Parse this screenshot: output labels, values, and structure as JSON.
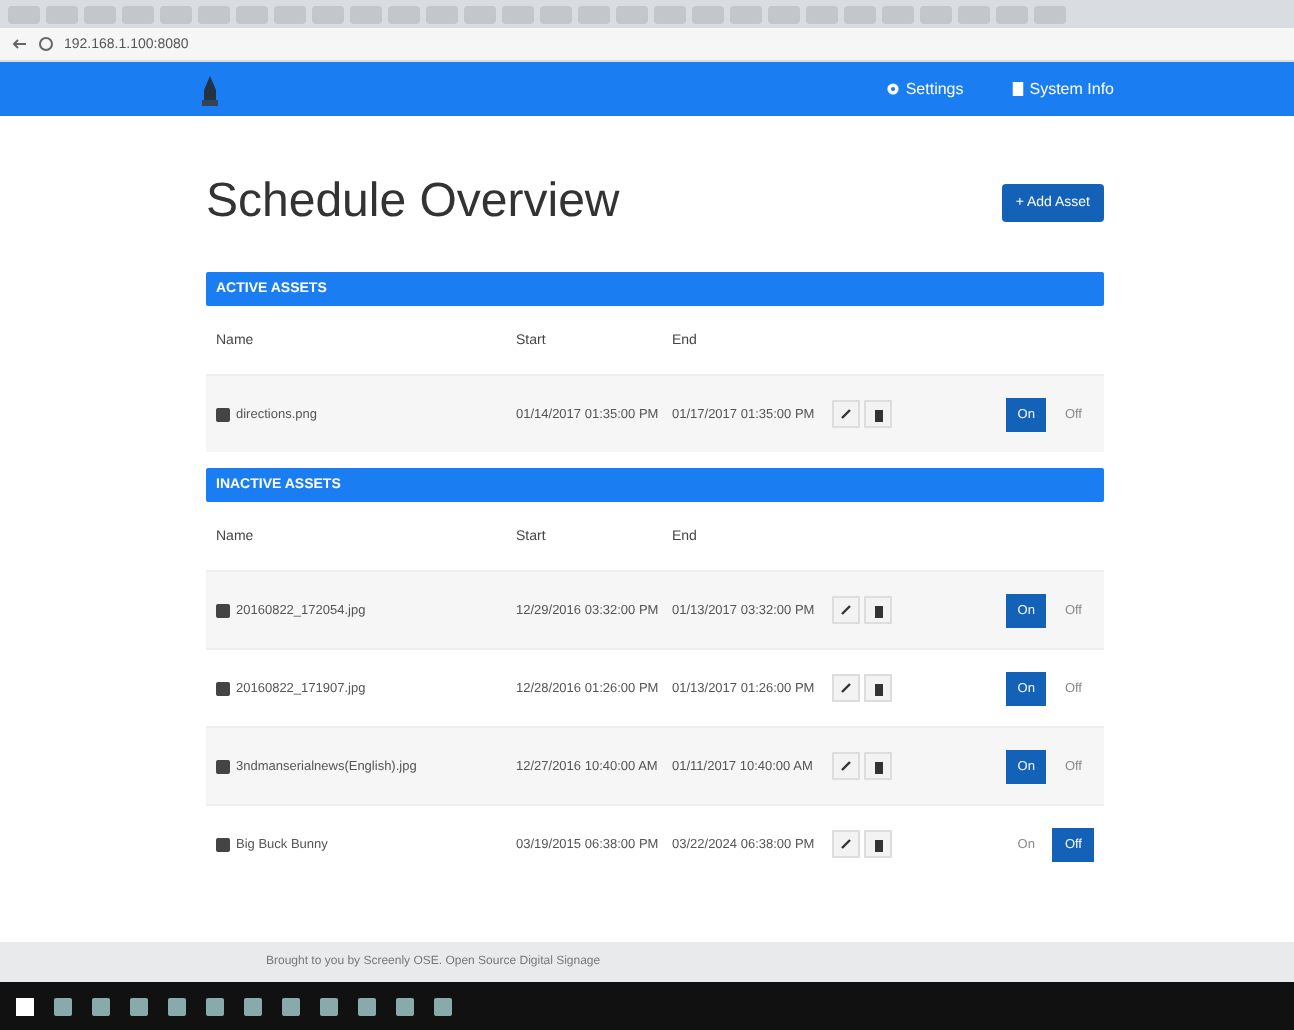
{
  "browser": {
    "url": "192.168.1.100:8080"
  },
  "navbar": {
    "links": [
      {
        "label": "Settings"
      },
      {
        "label": "System Info"
      }
    ]
  },
  "page": {
    "title": "Schedule Overview",
    "add_button": "+ Add Asset"
  },
  "sections": [
    {
      "title": "ACTIVE ASSETS",
      "columns": [
        "Name",
        "Start",
        "End"
      ],
      "rows": [
        {
          "name": "directions.png",
          "start": "01/14/2017 01:35:00 PM",
          "end": "01/17/2017 01:35:00 PM",
          "enabled": true,
          "on_label": "On",
          "off_label": "Off"
        }
      ]
    },
    {
      "title": "INACTIVE ASSETS",
      "columns": [
        "Name",
        "Start",
        "End"
      ],
      "rows": [
        {
          "name": "20160822_172054.jpg",
          "start": "12/29/2016 03:32:00 PM",
          "end": "01/13/2017 03:32:00 PM",
          "enabled": true,
          "on_label": "On",
          "off_label": "Off"
        },
        {
          "name": "20160822_171907.jpg",
          "start": "12/28/2016 01:26:00 PM",
          "end": "01/13/2017 01:26:00 PM",
          "enabled": true,
          "on_label": "On",
          "off_label": "Off"
        },
        {
          "name": "3ndmanserialnews(English).jpg",
          "start": "12/27/2016 10:40:00 AM",
          "end": "01/11/2017 10:40:00 AM",
          "enabled": true,
          "on_label": "On",
          "off_label": "Off"
        },
        {
          "name": "Big Buck Bunny",
          "start": "03/19/2015 06:38:00 PM",
          "end": "03/22/2024 06:38:00 PM",
          "enabled": false,
          "on_label": "On",
          "off_label": "Off"
        }
      ]
    }
  ],
  "footer": {
    "text": "Brought to you by Screenly OSE. Open Source Digital Signage"
  }
}
